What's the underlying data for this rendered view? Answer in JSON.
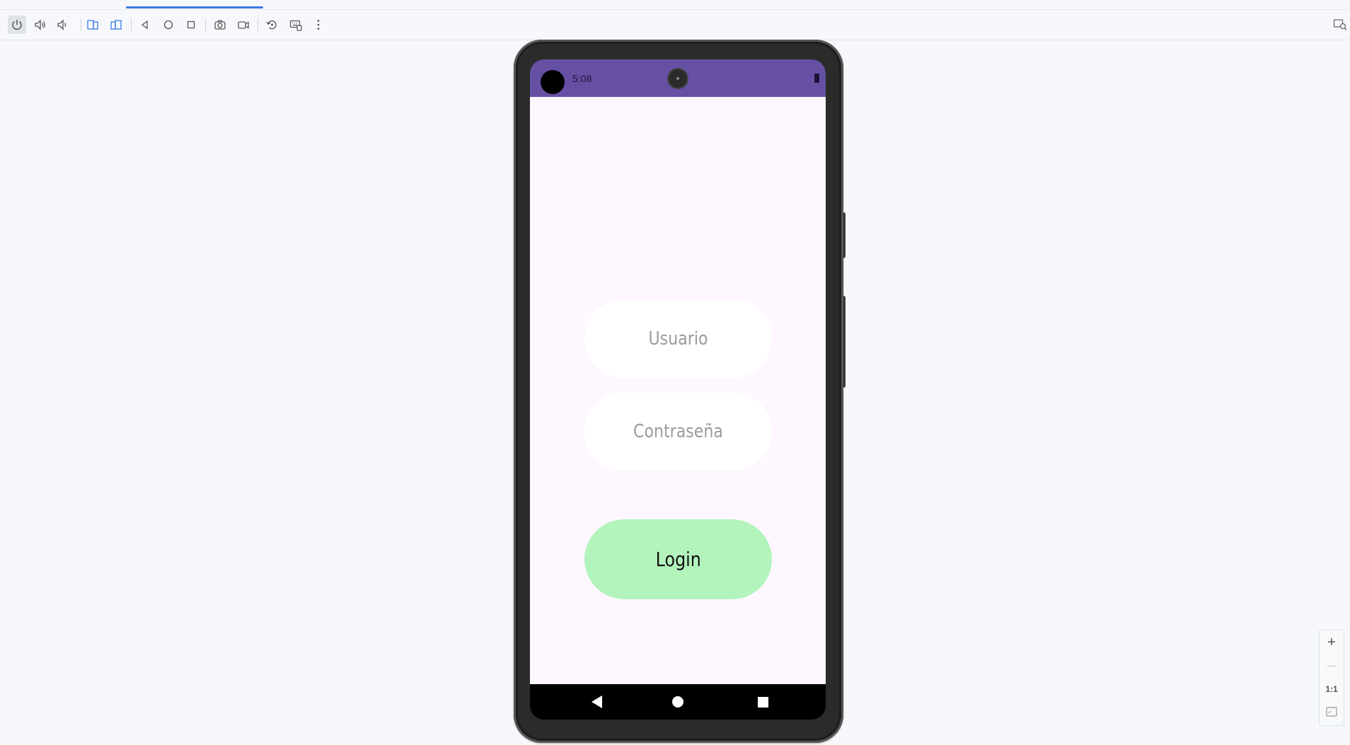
{
  "toolbar": {
    "buttons": [
      {
        "name": "power-icon"
      },
      {
        "name": "volume-up-icon"
      },
      {
        "name": "volume-down-icon"
      },
      {
        "name": "rotate-left-icon"
      },
      {
        "name": "rotate-right-icon"
      },
      {
        "name": "back-icon"
      },
      {
        "name": "home-icon"
      },
      {
        "name": "overview-icon"
      },
      {
        "name": "screenshot-icon"
      },
      {
        "name": "screen-record-icon"
      },
      {
        "name": "snapshot-icon"
      },
      {
        "name": "keyboard-icon"
      },
      {
        "name": "more-icon"
      }
    ]
  },
  "device": {
    "status_bar": {
      "time": "5:08",
      "color": "#6650a4"
    },
    "app": {
      "background": "#fef7ff",
      "username_placeholder": "Usuario",
      "password_placeholder": "Contraseña",
      "login_label": "Login",
      "login_color": "#b3f4bd"
    }
  },
  "zoom": {
    "zoom_in": "+",
    "zoom_out": "—",
    "actual_size": "1:1"
  }
}
